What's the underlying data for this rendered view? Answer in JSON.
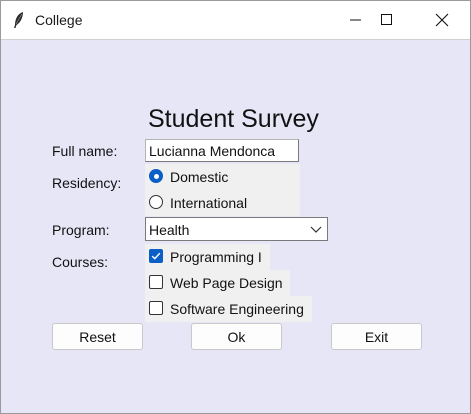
{
  "window": {
    "title": "College",
    "icon": "feather-icon"
  },
  "survey": {
    "heading": "Student Survey",
    "full_name_label": "Full name:",
    "full_name_value": "Lucianna Mendonca",
    "residency_label": "Residency:",
    "residency_options": [
      "Domestic",
      "International"
    ],
    "residency_selected": "Domestic",
    "program_label": "Program:",
    "program_value": "Health",
    "courses_label": "Courses:",
    "courses": [
      {
        "label": "Programming I",
        "checked": true
      },
      {
        "label": "Web Page Design",
        "checked": false
      },
      {
        "label": "Software Engineering",
        "checked": false
      }
    ]
  },
  "buttons": {
    "reset": "Reset",
    "ok": "Ok",
    "exit": "Exit"
  },
  "colors": {
    "background": "#e6e6f7",
    "accent": "#0a5fc7",
    "option_bg": "#f0f0f0"
  }
}
